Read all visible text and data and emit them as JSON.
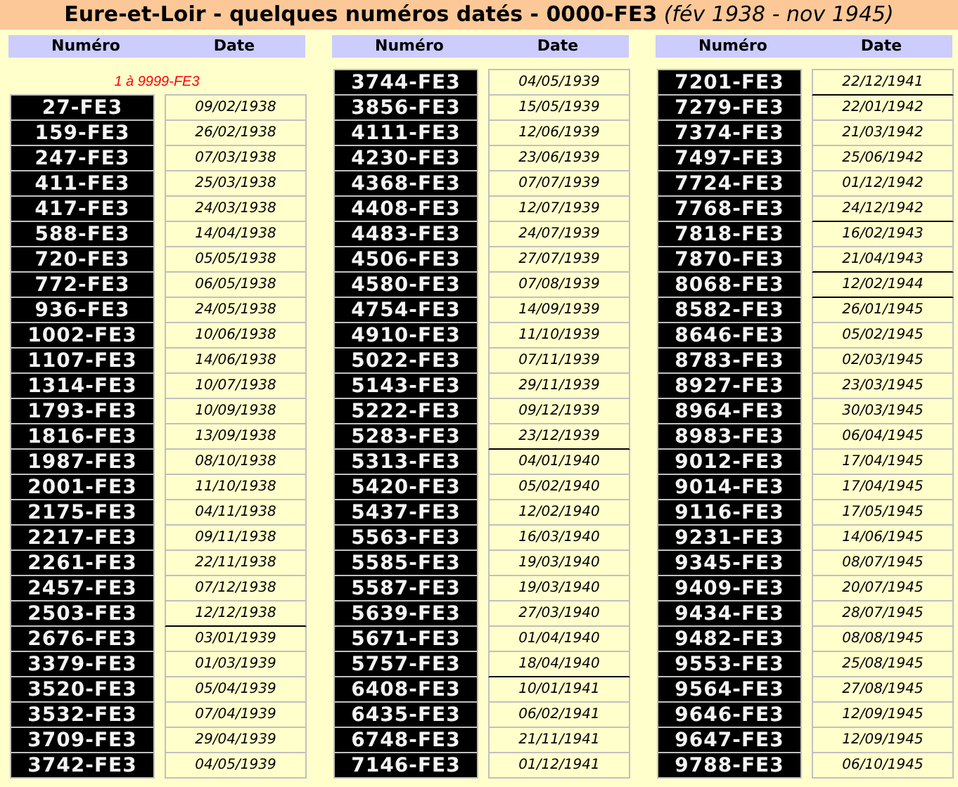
{
  "title": "**Eure-et-Loir - quelques numéros datés - 0000-FE3** *(fév 1938 - nov 1945)*",
  "columns": [
    {
      "header": {
        "numero": "Numéro",
        "date": "Date"
      },
      "note": "1 à 9999-FE3",
      "rows": [
        {
          "numero": "27-FE3",
          "date": "09/02/1938",
          "ends_year": false
        },
        {
          "numero": "159-FE3",
          "date": "26/02/1938",
          "ends_year": false
        },
        {
          "numero": "247-FE3",
          "date": "07/03/1938",
          "ends_year": false
        },
        {
          "numero": "411-FE3",
          "date": "25/03/1938",
          "ends_year": false
        },
        {
          "numero": "417-FE3",
          "date": "24/03/1938",
          "ends_year": false
        },
        {
          "numero": "588-FE3",
          "date": "14/04/1938",
          "ends_year": false
        },
        {
          "numero": "720-FE3",
          "date": "05/05/1938",
          "ends_year": false
        },
        {
          "numero": "772-FE3",
          "date": "06/05/1938",
          "ends_year": false
        },
        {
          "numero": "936-FE3",
          "date": "24/05/1938",
          "ends_year": false
        },
        {
          "numero": "1002-FE3",
          "date": "10/06/1938",
          "ends_year": false
        },
        {
          "numero": "1107-FE3",
          "date": "14/06/1938",
          "ends_year": false
        },
        {
          "numero": "1314-FE3",
          "date": "10/07/1938",
          "ends_year": false
        },
        {
          "numero": "1793-FE3",
          "date": "10/09/1938",
          "ends_year": false
        },
        {
          "numero": "1816-FE3",
          "date": "13/09/1938",
          "ends_year": false
        },
        {
          "numero": "1987-FE3",
          "date": "08/10/1938",
          "ends_year": false
        },
        {
          "numero": "2001-FE3",
          "date": "11/10/1938",
          "ends_year": false
        },
        {
          "numero": "2175-FE3",
          "date": "04/11/1938",
          "ends_year": false
        },
        {
          "numero": "2217-FE3",
          "date": "09/11/1938",
          "ends_year": false
        },
        {
          "numero": "2261-FE3",
          "date": "22/11/1938",
          "ends_year": false
        },
        {
          "numero": "2457-FE3",
          "date": "07/12/1938",
          "ends_year": false
        },
        {
          "numero": "2503-FE3",
          "date": "12/12/1938",
          "ends_year": true
        },
        {
          "numero": "2676-FE3",
          "date": "03/01/1939",
          "ends_year": false
        },
        {
          "numero": "3379-FE3",
          "date": "01/03/1939",
          "ends_year": false
        },
        {
          "numero": "3520-FE3",
          "date": "05/04/1939",
          "ends_year": false
        },
        {
          "numero": "3532-FE3",
          "date": "07/04/1939",
          "ends_year": false
        },
        {
          "numero": "3709-FE3",
          "date": "29/04/1939",
          "ends_year": false
        },
        {
          "numero": "3742-FE3",
          "date": "04/05/1939",
          "ends_year": false
        }
      ]
    },
    {
      "header": {
        "numero": "Numéro",
        "date": "Date"
      },
      "rows": [
        {
          "numero": "3744-FE3",
          "date": "04/05/1939",
          "ends_year": false
        },
        {
          "numero": "3856-FE3",
          "date": "15/05/1939",
          "ends_year": false
        },
        {
          "numero": "4111-FE3",
          "date": "12/06/1939",
          "ends_year": false
        },
        {
          "numero": "4230-FE3",
          "date": "23/06/1939",
          "ends_year": false
        },
        {
          "numero": "4368-FE3",
          "date": "07/07/1939",
          "ends_year": false
        },
        {
          "numero": "4408-FE3",
          "date": "12/07/1939",
          "ends_year": false
        },
        {
          "numero": "4483-FE3",
          "date": "24/07/1939",
          "ends_year": false
        },
        {
          "numero": "4506-FE3",
          "date": "27/07/1939",
          "ends_year": false
        },
        {
          "numero": "4580-FE3",
          "date": "07/08/1939",
          "ends_year": false
        },
        {
          "numero": "4754-FE3",
          "date": "14/09/1939",
          "ends_year": false
        },
        {
          "numero": "4910-FE3",
          "date": "11/10/1939",
          "ends_year": false
        },
        {
          "numero": "5022-FE3",
          "date": "07/11/1939",
          "ends_year": false
        },
        {
          "numero": "5143-FE3",
          "date": "29/11/1939",
          "ends_year": false
        },
        {
          "numero": "5222-FE3",
          "date": "09/12/1939",
          "ends_year": false
        },
        {
          "numero": "5283-FE3",
          "date": "23/12/1939",
          "ends_year": true
        },
        {
          "numero": "5313-FE3",
          "date": "04/01/1940",
          "ends_year": false
        },
        {
          "numero": "5420-FE3",
          "date": "05/02/1940",
          "ends_year": false
        },
        {
          "numero": "5437-FE3",
          "date": "12/02/1940",
          "ends_year": false
        },
        {
          "numero": "5563-FE3",
          "date": "16/03/1940",
          "ends_year": false
        },
        {
          "numero": "5585-FE3",
          "date": "19/03/1940",
          "ends_year": false
        },
        {
          "numero": "5587-FE3",
          "date": "19/03/1940",
          "ends_year": false
        },
        {
          "numero": "5639-FE3",
          "date": "27/03/1940",
          "ends_year": false
        },
        {
          "numero": "5671-FE3",
          "date": "01/04/1940",
          "ends_year": false
        },
        {
          "numero": "5757-FE3",
          "date": "18/04/1940",
          "ends_year": true
        },
        {
          "numero": "6408-FE3",
          "date": "10/01/1941",
          "ends_year": false
        },
        {
          "numero": "6435-FE3",
          "date": "06/02/1941",
          "ends_year": false
        },
        {
          "numero": "6748-FE3",
          "date": "21/11/1941",
          "ends_year": false
        },
        {
          "numero": "7146-FE3",
          "date": "01/12/1941",
          "ends_year": false
        }
      ]
    },
    {
      "header": {
        "numero": "Numéro",
        "date": "Date"
      },
      "rows": [
        {
          "numero": "7201-FE3",
          "date": "22/12/1941",
          "ends_year": true
        },
        {
          "numero": "7279-FE3",
          "date": "22/01/1942",
          "ends_year": false
        },
        {
          "numero": "7374-FE3",
          "date": "21/03/1942",
          "ends_year": false
        },
        {
          "numero": "7497-FE3",
          "date": "25/06/1942",
          "ends_year": false
        },
        {
          "numero": "7724-FE3",
          "date": "01/12/1942",
          "ends_year": false
        },
        {
          "numero": "7768-FE3",
          "date": "24/12/1942",
          "ends_year": true
        },
        {
          "numero": "7818-FE3",
          "date": "16/02/1943",
          "ends_year": false
        },
        {
          "numero": "7870-FE3",
          "date": "21/04/1943",
          "ends_year": true
        },
        {
          "numero": "8068-FE3",
          "date": "12/02/1944",
          "ends_year": true
        },
        {
          "numero": "8582-FE3",
          "date": "26/01/1945",
          "ends_year": false
        },
        {
          "numero": "8646-FE3",
          "date": "05/02/1945",
          "ends_year": false
        },
        {
          "numero": "8783-FE3",
          "date": "02/03/1945",
          "ends_year": false
        },
        {
          "numero": "8927-FE3",
          "date": "23/03/1945",
          "ends_year": false
        },
        {
          "numero": "8964-FE3",
          "date": "30/03/1945",
          "ends_year": false
        },
        {
          "numero": "8983-FE3",
          "date": "06/04/1945",
          "ends_year": false
        },
        {
          "numero": "9012-FE3",
          "date": "17/04/1945",
          "ends_year": false
        },
        {
          "numero": "9014-FE3",
          "date": "17/04/1945",
          "ends_year": false
        },
        {
          "numero": "9116-FE3",
          "date": "17/05/1945",
          "ends_year": false
        },
        {
          "numero": "9231-FE3",
          "date": "14/06/1945",
          "ends_year": false
        },
        {
          "numero": "9345-FE3",
          "date": "08/07/1945",
          "ends_year": false
        },
        {
          "numero": "9409-FE3",
          "date": "20/07/1945",
          "ends_year": false
        },
        {
          "numero": "9434-FE3",
          "date": "28/07/1945",
          "ends_year": false
        },
        {
          "numero": "9482-FE3",
          "date": "08/08/1945",
          "ends_year": false
        },
        {
          "numero": "9553-FE3",
          "date": "25/08/1945",
          "ends_year": false
        },
        {
          "numero": "9564-FE3",
          "date": "27/08/1945",
          "ends_year": false
        },
        {
          "numero": "9646-FE3",
          "date": "12/09/1945",
          "ends_year": false
        },
        {
          "numero": "9647-FE3",
          "date": "12/09/1945",
          "ends_year": false
        },
        {
          "numero": "9788-FE3",
          "date": "06/10/1945",
          "ends_year": false
        }
      ]
    }
  ]
}
